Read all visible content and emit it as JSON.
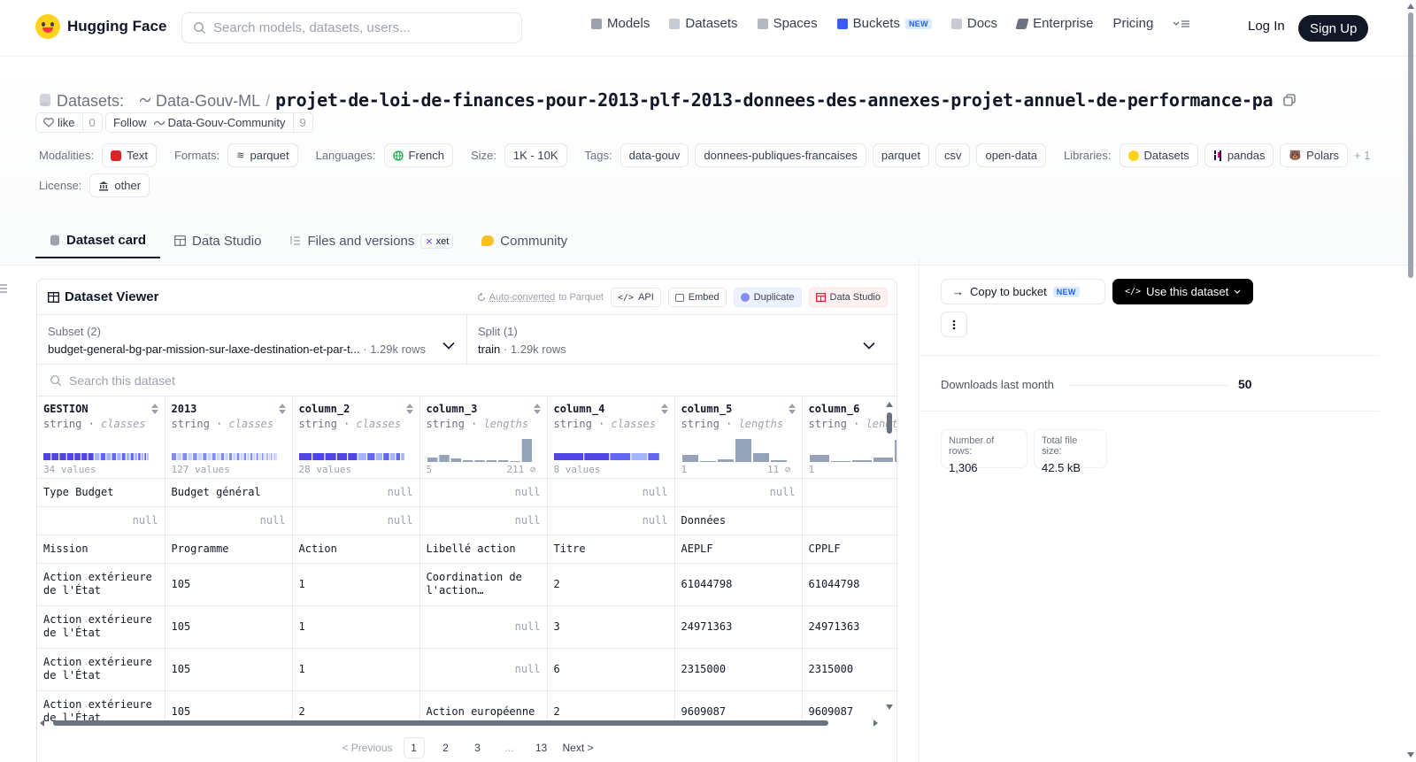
{
  "header": {
    "brand": "Hugging Face",
    "search_placeholder": "Search models, datasets, users...",
    "nav": [
      {
        "label": "Models"
      },
      {
        "label": "Datasets"
      },
      {
        "label": "Spaces"
      },
      {
        "label": "Buckets",
        "badge": "NEW"
      },
      {
        "label": "Docs"
      },
      {
        "label": "Enterprise"
      },
      {
        "label": "Pricing"
      }
    ],
    "login": "Log In",
    "signup": "Sign Up"
  },
  "dataset": {
    "type_label": "Datasets:",
    "org": "Data-Gouv-ML",
    "sep": "/",
    "name": "projet-de-loi-de-finances-pour-2013-plf-2013-donnees-des-annexes-projet-annuel-de-performance-pa",
    "like_label": "like",
    "like_count": "0",
    "follow_label": "Follow",
    "follow_org": "Data-Gouv-Community",
    "follow_count": "9"
  },
  "meta": {
    "modalities_label": "Modalities:",
    "modality": "Text",
    "formats_label": "Formats:",
    "format": "parquet",
    "languages_label": "Languages:",
    "language": "French",
    "size_label": "Size:",
    "size": "1K - 10K",
    "tags_label": "Tags:",
    "tags": [
      "data-gouv",
      "donnees-publiques-francaises",
      "parquet",
      "csv",
      "open-data"
    ],
    "libraries_label": "Libraries:",
    "libraries": [
      "Datasets",
      "pandas",
      "Polars"
    ],
    "libraries_more": "+ 1",
    "license_label": "License:",
    "license": "other"
  },
  "tabs": [
    {
      "label": "Dataset card"
    },
    {
      "label": "Data Studio"
    },
    {
      "label": "Files and versions",
      "badge": "xet"
    },
    {
      "label": "Community"
    }
  ],
  "viewer": {
    "title": "Dataset Viewer",
    "auto_converted": "Auto-converted",
    "to_parquet": "to Parquet",
    "api": "API",
    "embed": "Embed",
    "duplicate": "Duplicate",
    "data_studio": "Data Studio",
    "subset_label": "Subset (2)",
    "subset_value": "budget-general-bg-par-mission-sur-laxe-destination-et-par-t...",
    "subset_rows": "1.29k rows",
    "split_label": "Split (1)",
    "split_value": "train",
    "split_rows": "1.29k rows",
    "search_placeholder": "Search this dataset",
    "columns": [
      {
        "name": "GESTION",
        "type": "string",
        "kind": "classes",
        "foot_left": "34 values",
        "foot_right": ""
      },
      {
        "name": "2013",
        "type": "string",
        "kind": "classes",
        "foot_left": "127 values",
        "foot_right": ""
      },
      {
        "name": "column_2",
        "type": "string",
        "kind": "classes",
        "foot_left": "28 values",
        "foot_right": ""
      },
      {
        "name": "column_3",
        "type": "string",
        "kind": "lengths",
        "foot_left": "5",
        "foot_right": "211 ⊘"
      },
      {
        "name": "column_4",
        "type": "string",
        "kind": "classes",
        "foot_left": "8 values",
        "foot_right": ""
      },
      {
        "name": "column_5",
        "type": "string",
        "kind": "lengths",
        "foot_left": "1",
        "foot_right": "11 ⊘"
      },
      {
        "name": "column_6",
        "type": "string",
        "kind": "lengths",
        "foot_left": "1",
        "foot_right": ""
      }
    ],
    "rows": [
      [
        "Type Budget",
        "Budget général",
        null,
        null,
        null,
        null,
        ""
      ],
      [
        null,
        null,
        null,
        null,
        null,
        "Données",
        ""
      ],
      [
        "Mission",
        "Programme",
        "Action",
        "Libellé action",
        "Titre",
        "AEPLF",
        "CPPLF"
      ],
      [
        "Action extérieure de l'État",
        "105",
        "1",
        "Coordination de l'action…",
        "2",
        "61044798",
        "61044798"
      ],
      [
        "Action extérieure de l'État",
        "105",
        "1",
        null,
        "3",
        "24971363",
        "24971363"
      ],
      [
        "Action extérieure de l'État",
        "105",
        "1",
        null,
        "6",
        "2315000",
        "2315000"
      ],
      [
        "Action extérieure de l'État",
        "105",
        "2",
        "Action européenne",
        "2",
        "9609087",
        "9609087"
      ]
    ],
    "null_text": "null",
    "pager": {
      "prev": "< Previous",
      "pages": [
        "1",
        "2",
        "3",
        "...",
        "13"
      ],
      "next": "Next >"
    }
  },
  "side": {
    "copy_bucket": "Copy to bucket",
    "copy_badge": "NEW",
    "use_dataset": "Use this dataset",
    "downloads_label": "Downloads last month",
    "downloads": "50",
    "rows_label": "Number of rows:",
    "rows_value": "1,306",
    "size_label": "Total file size:",
    "size_value": "42.5 kB"
  }
}
